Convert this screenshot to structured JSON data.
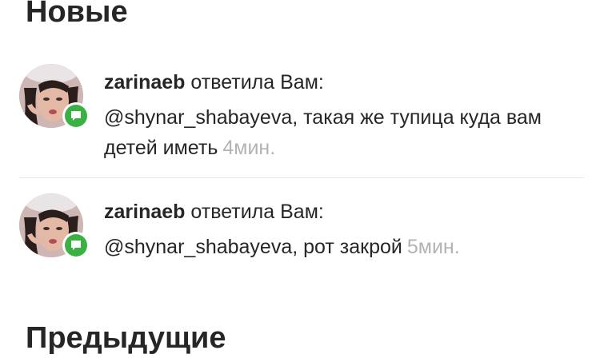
{
  "sections": {
    "new_title": "Новые",
    "previous_title": "Предыдущие"
  },
  "notifications": [
    {
      "username": "zarinaeb",
      "action": "ответила Вам:",
      "message": "@shynar_shabayeva, такая же тупица куда вам детей иметь",
      "time": "4мин.",
      "badge_icon": "comment-bubble-icon",
      "badge_color": "#3bb043"
    },
    {
      "username": "zarinaeb",
      "action": "ответила Вам:",
      "message": "@shynar_shabayeva, рот закрой",
      "time": "5мин.",
      "badge_icon": "comment-bubble-icon",
      "badge_color": "#3bb043"
    }
  ]
}
